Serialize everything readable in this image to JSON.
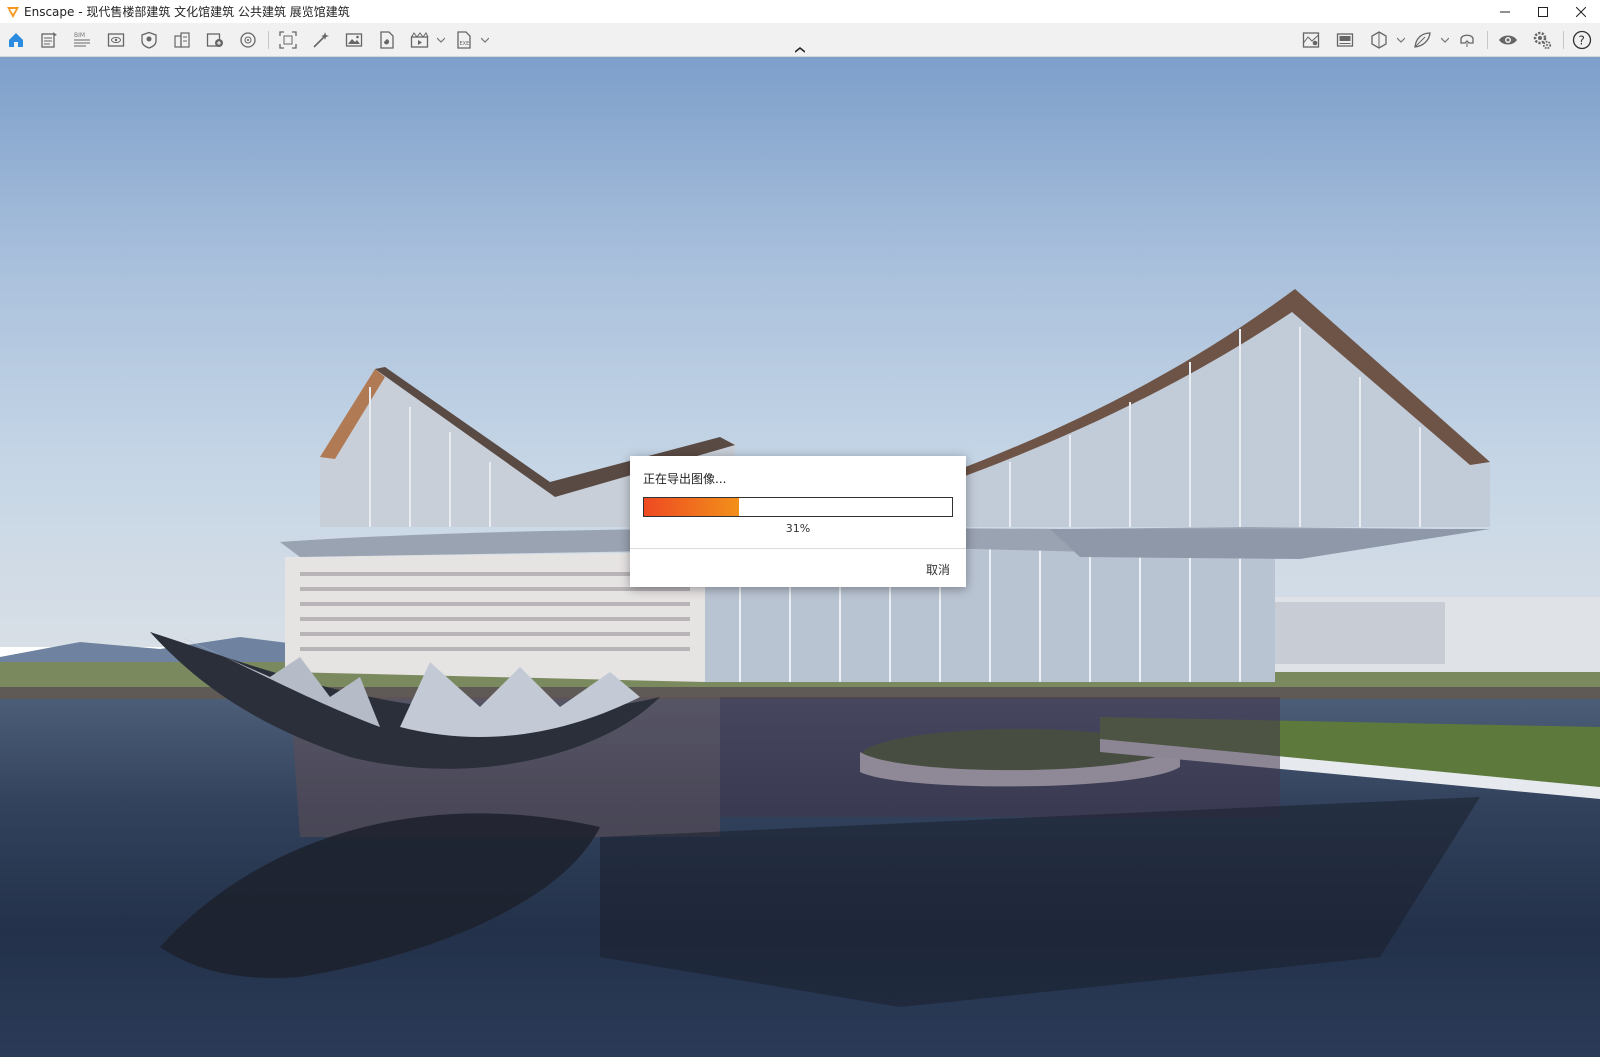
{
  "window": {
    "title": "Enscape - 现代售楼部建筑 文化馆建筑 公共建筑 展览馆建筑"
  },
  "toolbar": {
    "left_icons": [
      "home-icon",
      "asset-library-icon",
      "bim-icon",
      "view-icon",
      "visual-settings-icon",
      "building-icon",
      "add-view-icon",
      "panorama-icon",
      "screenshot-icon",
      "magic-wand-icon",
      "image-icon",
      "export-file-icon",
      "batch-render-icon",
      "exe-export-icon"
    ],
    "right_icons": [
      "map-icon",
      "image-gallery-icon",
      "section-icon",
      "leaf-icon",
      "vr-headset-icon",
      "eye-icon",
      "settings-gears-icon",
      "help-icon"
    ]
  },
  "dialog": {
    "title": "正在导出图像...",
    "progress": 0.31,
    "percent_label": "31%",
    "cancel_label": "取消"
  },
  "colors": {
    "progress_start": "#ee4a22",
    "progress_end": "#f2901a",
    "accent": "#2a8be0"
  }
}
